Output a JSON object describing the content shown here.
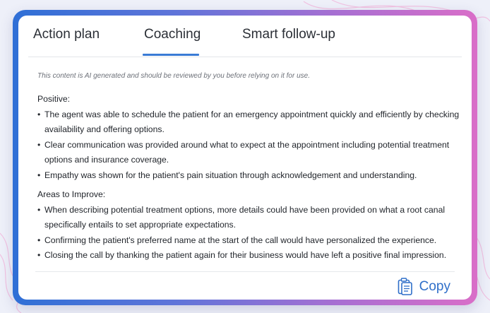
{
  "tabs": [
    {
      "label": "Action plan",
      "selected": false
    },
    {
      "label": "Coaching",
      "selected": true
    },
    {
      "label": "Smart follow-up",
      "selected": false
    }
  ],
  "disclaimer": "This content is AI generated and should be reviewed by you before relying on it for use.",
  "sections": [
    {
      "heading": "Positive:",
      "items": [
        "The agent was able to schedule the patient for an emergency appointment quickly and efficiently by checking availability and offering options.",
        "Clear communication was provided around what to expect at the appointment including potential treatment options and insurance coverage.",
        "Empathy was shown for the patient's pain situation through acknowledgement and understanding."
      ]
    },
    {
      "heading": "Areas to Improve:",
      "items": [
        "When describing potential treatment options, more details could have been provided on what a root canal specifically entails to set appropriate expectations.",
        "Confirming the patient's preferred name at the start of the call would have personalized the experience.",
        "Closing the call by thanking the patient again for their business would have left a positive final impression."
      ]
    }
  ],
  "copy_button": {
    "label": "Copy",
    "icon": "clipboard-icon"
  },
  "colors": {
    "accent": "#3a7bd5",
    "copy": "#2f6fc9",
    "frame_gradient": [
      "#2f6fd6",
      "#a86fd2",
      "#d96ec8"
    ],
    "background": "#eef0f9"
  }
}
